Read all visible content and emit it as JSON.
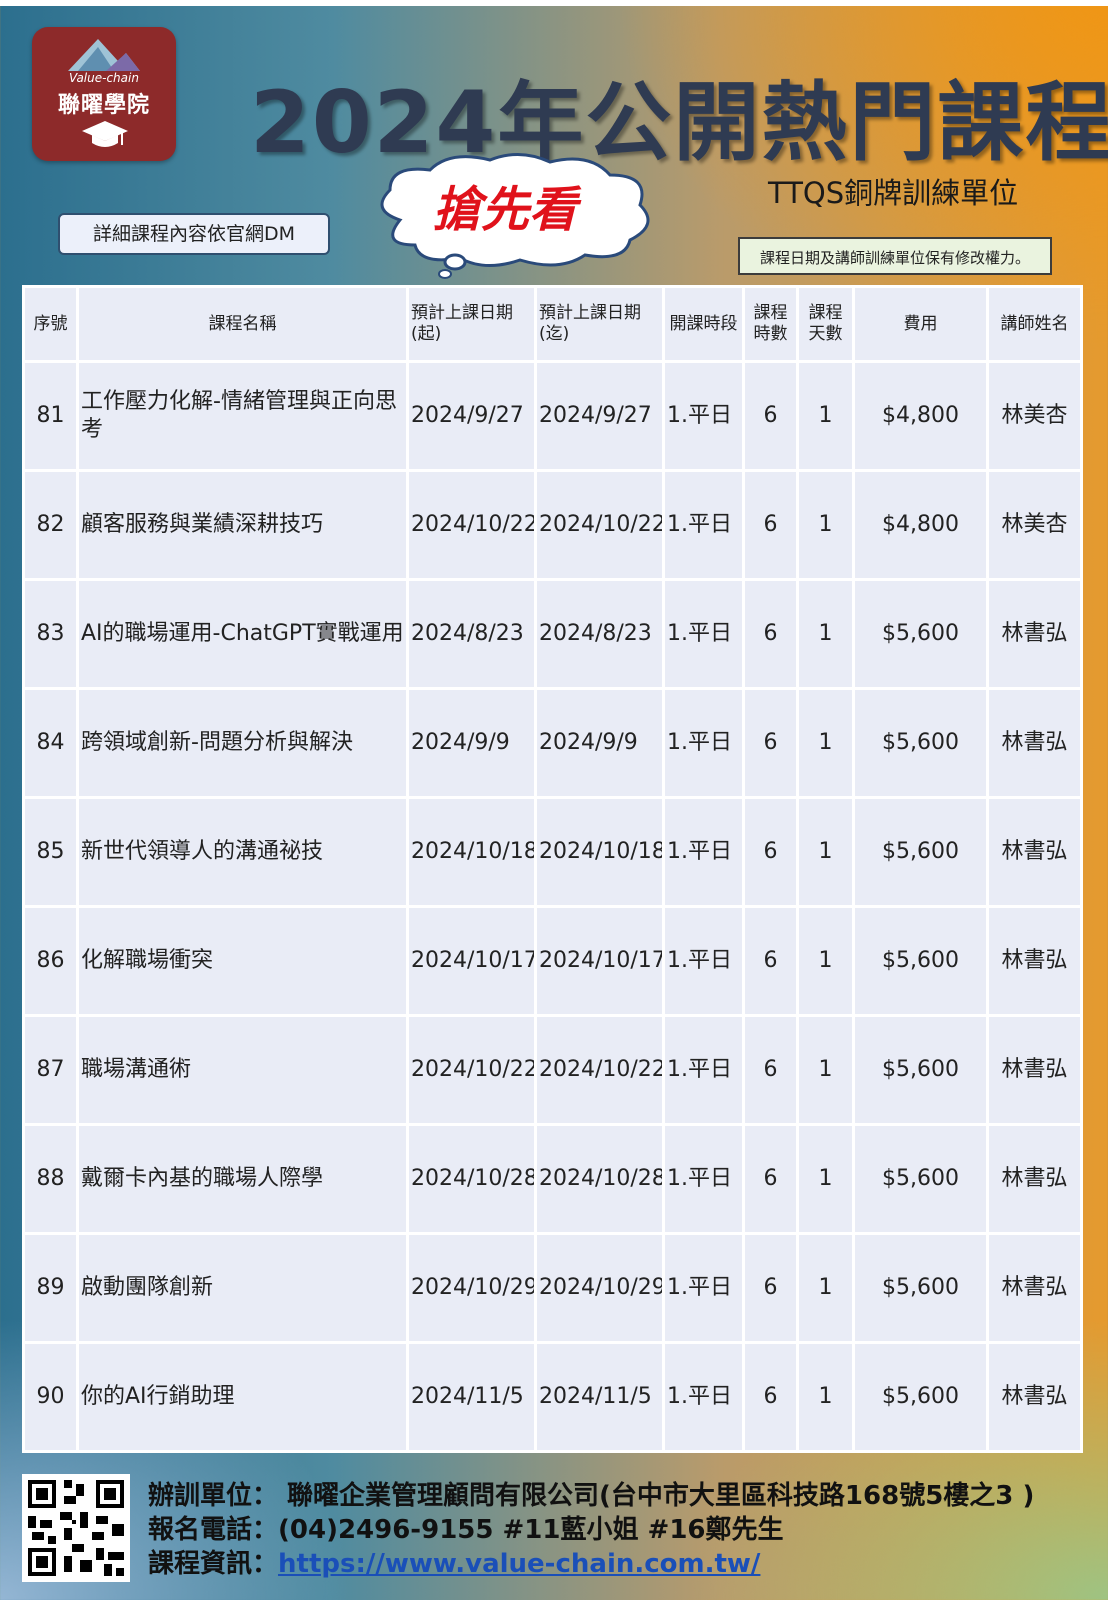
{
  "logo": {
    "en": "Value-chain",
    "zh": "聯曜學院"
  },
  "title": "2024年公開熱門課程",
  "badge": "搶先看",
  "ttqs": "TTQS銅牌訓練單位",
  "dm_note": "詳細課程內容依官網DM",
  "rights_note": "課程日期及講師訓練單位保有修改權力。",
  "table": {
    "headers": [
      "序號",
      "課程名稱",
      "預計上課日期(起)",
      "預計上課日期(迄)",
      "開課時段",
      "課程時數",
      "課程天數",
      "費用",
      "講師姓名"
    ],
    "rows": [
      [
        "81",
        "工作壓力化解-情緒管理與正向思考",
        "2024/9/27",
        "2024/9/27",
        "1.平日",
        "6",
        "1",
        "$4,800",
        "林美杏"
      ],
      [
        "82",
        "顧客服務與業績深耕技巧",
        "2024/10/22",
        "2024/10/22",
        "1.平日",
        "6",
        "1",
        "$4,800",
        "林美杏"
      ],
      [
        "83",
        "AI的職場運用-ChatGPT實戰運用",
        "2024/8/23",
        "2024/8/23",
        "1.平日",
        "6",
        "1",
        "$5,600",
        "林書弘"
      ],
      [
        "84",
        "跨領域創新-問題分析與解決",
        "2024/9/9",
        "2024/9/9",
        "1.平日",
        "6",
        "1",
        "$5,600",
        "林書弘"
      ],
      [
        "85",
        "新世代領導人的溝通祕技",
        "2024/10/18",
        "2024/10/18",
        "1.平日",
        "6",
        "1",
        "$5,600",
        "林書弘"
      ],
      [
        "86",
        "化解職場衝突",
        "2024/10/17",
        "2024/10/17",
        "1.平日",
        "6",
        "1",
        "$5,600",
        "林書弘"
      ],
      [
        "87",
        "職場溝通術",
        "2024/10/22",
        "2024/10/22",
        "1.平日",
        "6",
        "1",
        "$5,600",
        "林書弘"
      ],
      [
        "88",
        "戴爾卡內基的職場人際學",
        "2024/10/28",
        "2024/10/28",
        "1.平日",
        "6",
        "1",
        "$5,600",
        "林書弘"
      ],
      [
        "89",
        "啟動團隊創新",
        "2024/10/29",
        "2024/10/29",
        "1.平日",
        "6",
        "1",
        "$5,600",
        "林書弘"
      ],
      [
        "90",
        "你的AI行銷助理",
        "2024/11/5",
        "2024/11/5",
        "1.平日",
        "6",
        "1",
        "$5,600",
        "林書弘"
      ]
    ]
  },
  "footer": {
    "organizer": "辦訓單位： 聯曜企業管理顧問有限公司(台中市大里區科技路168號5樓之3 )",
    "phone": "報名電話：(04)2496-9155 #11藍小姐 #16鄭先生",
    "info_label": "課程資訊：",
    "info_url": "https://www.value-chain.com.tw/"
  },
  "colors": {
    "title": "#2f3b52",
    "badge": "#e0121b",
    "logo_bg": "#8d2a2a",
    "table_bg": "#e9ecf6",
    "link": "#1a4fb8"
  }
}
